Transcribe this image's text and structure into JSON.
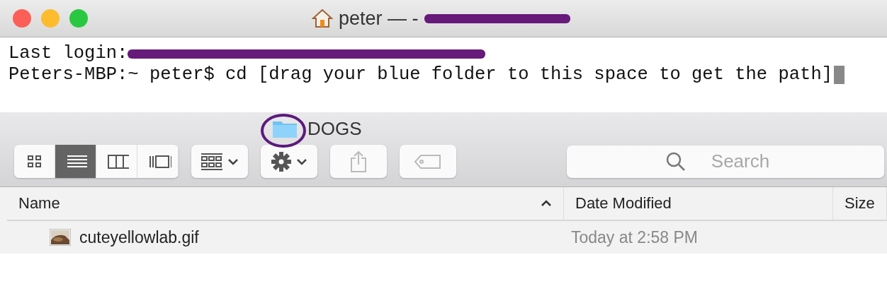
{
  "terminal": {
    "title": "peter — -",
    "lines": [
      {
        "text": "Last login:",
        "redacted": true
      },
      {
        "text": "Peters-MBP:~ peter$ cd [drag your blue folder to this space to get the path]",
        "cursor": true
      }
    ]
  },
  "finder": {
    "title": "DOGS",
    "view_modes": [
      {
        "kind": "icons",
        "selected": false
      },
      {
        "kind": "list",
        "selected": true
      },
      {
        "kind": "columns",
        "selected": false
      },
      {
        "kind": "gallery",
        "selected": false
      }
    ],
    "tools": [
      {
        "kind": "arrange"
      },
      {
        "kind": "action"
      },
      {
        "kind": "share"
      },
      {
        "kind": "tag"
      }
    ],
    "search": {
      "placeholder": "Search"
    },
    "columns": [
      {
        "label": "Name",
        "sorted": true
      },
      {
        "label": "Date Modified",
        "sorted": false
      },
      {
        "label": "Size",
        "sorted": false
      }
    ],
    "rows": [
      {
        "name": "cuteyellowlab.gif",
        "date": "Today at 2:58 PM"
      }
    ]
  }
}
